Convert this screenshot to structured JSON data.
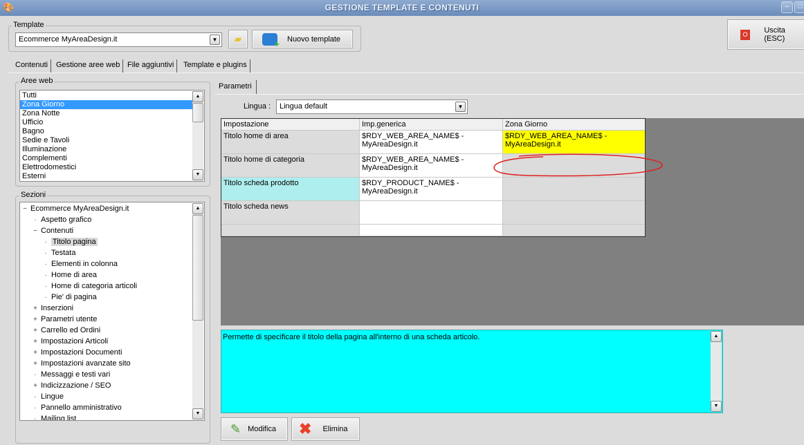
{
  "window": {
    "title": "GESTIONE TEMPLATE E CONTENUTI"
  },
  "template": {
    "group_label": "Template",
    "selected": "Ecommerce MyAreaDesign.it",
    "new_button": "Nuovo template"
  },
  "exit_button": "Uscita (ESC)",
  "tabs": [
    "Contenuti",
    "Gestione aree web",
    "File aggiuntivi",
    "Template e plugins"
  ],
  "aree_web": {
    "label": "Aree web",
    "items": [
      "Tutti",
      "Zona Giorno",
      "Zona Notte",
      "Ufficio",
      "Bagno",
      "Sedie e Tavoli",
      "Illuminazione",
      "Complementi",
      "Elettrodomestici",
      "Esterni"
    ],
    "selected_index": 1
  },
  "sezioni": {
    "label": "Sezioni",
    "tree": [
      {
        "label": "Ecommerce MyAreaDesign.it",
        "level": 0,
        "toggle": "−"
      },
      {
        "label": "Aspetto grafico",
        "level": 1,
        "toggle": ""
      },
      {
        "label": "Contenuti",
        "level": 1,
        "toggle": "−"
      },
      {
        "label": "Titolo pagina",
        "level": 2,
        "toggle": "",
        "selected": true
      },
      {
        "label": "Testata",
        "level": 2,
        "toggle": ""
      },
      {
        "label": "Elementi in colonna",
        "level": 2,
        "toggle": ""
      },
      {
        "label": "Home di area",
        "level": 2,
        "toggle": ""
      },
      {
        "label": "Home di categoria articoli",
        "level": 2,
        "toggle": ""
      },
      {
        "label": "Pie' di pagina",
        "level": 2,
        "toggle": ""
      },
      {
        "label": "Inserzioni",
        "level": 1,
        "toggle": "+"
      },
      {
        "label": "Parametri utente",
        "level": 1,
        "toggle": "+"
      },
      {
        "label": "Carrello ed Ordini",
        "level": 1,
        "toggle": "+"
      },
      {
        "label": "Impostazioni Articoli",
        "level": 1,
        "toggle": "+"
      },
      {
        "label": "Impostazioni Documenti",
        "level": 1,
        "toggle": "+"
      },
      {
        "label": "Impostazioni avanzate sito",
        "level": 1,
        "toggle": "+"
      },
      {
        "label": "Messaggi e testi vari",
        "level": 1,
        "toggle": ""
      },
      {
        "label": "Indicizzazione / SEO",
        "level": 1,
        "toggle": "+"
      },
      {
        "label": "Lingue",
        "level": 1,
        "toggle": ""
      },
      {
        "label": "Pannello amministrativo",
        "level": 1,
        "toggle": ""
      },
      {
        "label": "Mailing list",
        "level": 1,
        "toggle": ""
      }
    ]
  },
  "parametri": {
    "tab": "Parametri",
    "lingua_label": "Lingua :",
    "lingua_value": "Lingua default",
    "columns": [
      "Impostazione",
      "Imp.generica",
      "Zona Giorno"
    ],
    "rows": [
      {
        "name": "Titolo home di area",
        "generic": "$RDY_WEB_AREA_NAME$ - MyAreaDesign.it",
        "zone": "$RDY_WEB_AREA_NAME$ - MyAreaDesign.it"
      },
      {
        "name": "Titolo home di categoria",
        "generic": "$RDY_WEB_AREA_NAME$ - MyAreaDesign.it",
        "zone": ""
      },
      {
        "name": "Titolo scheda prodotto",
        "generic": "$RDY_PRODUCT_NAME$ - MyAreaDesign.it",
        "zone": ""
      },
      {
        "name": "Titolo scheda news",
        "generic": "",
        "zone": ""
      },
      {
        "name": "",
        "generic": "",
        "zone": ""
      }
    ],
    "description": "Permette di specificare il titolo della pagina all'interno di una scheda articolo.",
    "modify_button": "Modifica",
    "delete_button": "Elimina"
  },
  "colors": {
    "selection": "#3399ff",
    "highlight_yellow": "#ffff00",
    "highlight_cyan": "#aeeeee",
    "description_bg": "#00ffff",
    "annotation": "#e02020"
  }
}
